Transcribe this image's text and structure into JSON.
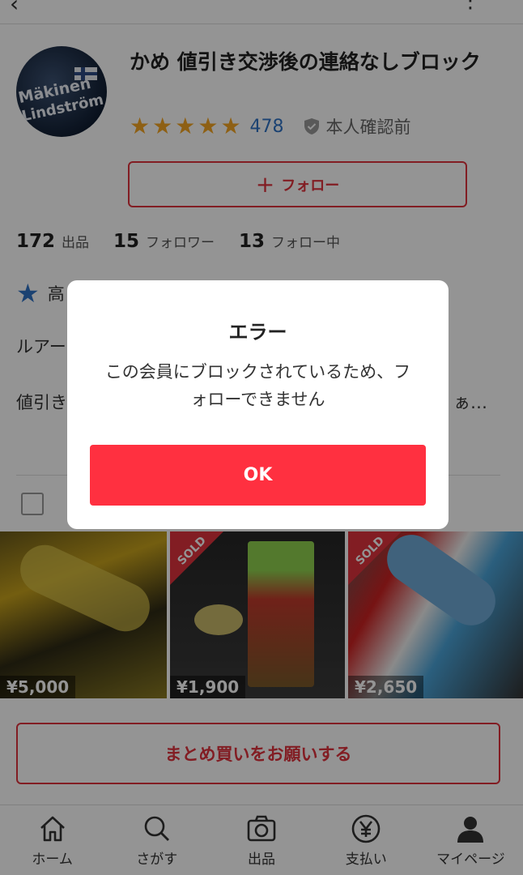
{
  "header": {
    "back_glyph": "‹",
    "more_glyph": "⋮"
  },
  "avatar": {
    "line1": "Mäkinen",
    "line2": "Lindström"
  },
  "profile": {
    "name": "かめ 値引き交渉後の連絡なしブロック",
    "rating": 5,
    "rating_count": "478",
    "verification": "本人確認前"
  },
  "follow_button": {
    "plus": "+",
    "label": "フォロー"
  },
  "stats": [
    {
      "number": "172",
      "label": "出品"
    },
    {
      "number": "15",
      "label": "フォロワー"
    },
    {
      "number": "13",
      "label": "フォロー中"
    }
  ],
  "badge": {
    "text": "高"
  },
  "bio": {
    "line1": "ルアー",
    "line2": "値引き",
    "line2_tail": "ぁ…"
  },
  "products": [
    {
      "price": "¥5,000",
      "sold": false
    },
    {
      "price": "¥1,900",
      "sold": true,
      "sold_label": "SOLD"
    },
    {
      "price": "¥2,650",
      "sold": true,
      "sold_label": "SOLD"
    }
  ],
  "bundle_button": {
    "label": "まとめ買いをお願いする"
  },
  "tabs": [
    {
      "label": "ホーム",
      "icon": "home-icon"
    },
    {
      "label": "さがす",
      "icon": "search-icon"
    },
    {
      "label": "出品",
      "icon": "camera-icon"
    },
    {
      "label": "支払い",
      "icon": "yen-icon"
    },
    {
      "label": "マイページ",
      "icon": "person-icon"
    }
  ],
  "dialog": {
    "title": "エラー",
    "message": "この会員にブロックされているため、フォローできません",
    "ok_label": "OK"
  },
  "colors": {
    "accent": "#e0323d",
    "ok_button": "#ff3040",
    "star": "#f5a623",
    "link": "#2f73c4"
  }
}
